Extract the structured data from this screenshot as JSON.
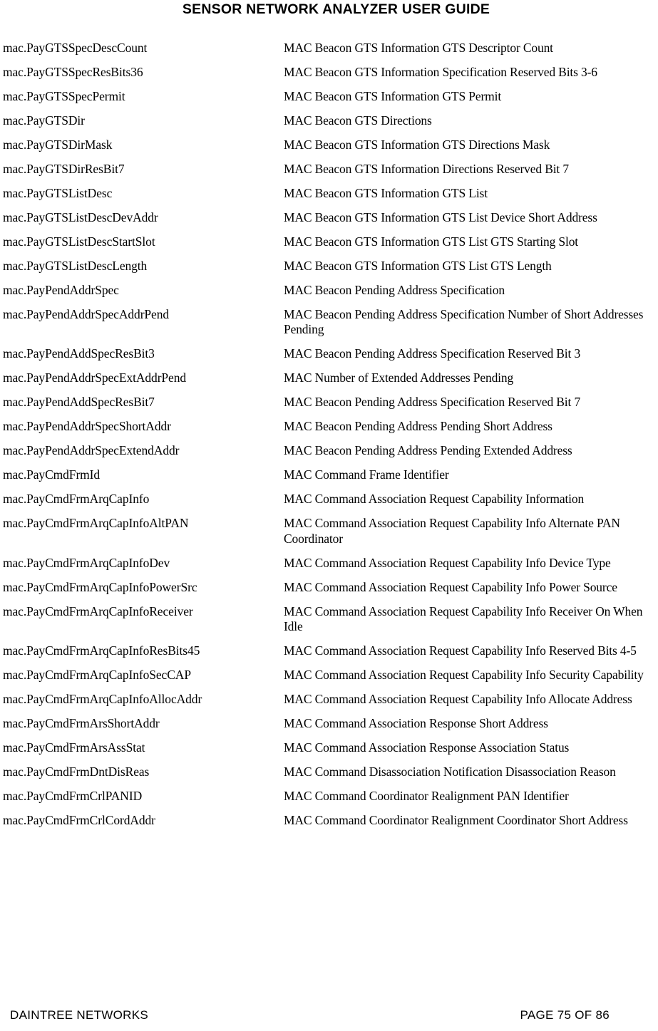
{
  "header": {
    "title": "SENSOR NETWORK ANALYZER USER GUIDE"
  },
  "footer": {
    "left": "DAINTREE NETWORKS",
    "right": "PAGE 75 OF 86"
  },
  "glossary": {
    "rows": [
      {
        "term": "mac.PayGTSSpecDescCount",
        "definition": "MAC Beacon GTS Information GTS Descriptor Count"
      },
      {
        "term": "mac.PayGTSSpecResBits36",
        "definition": "MAC Beacon GTS Information Specification Reserved Bits 3-6"
      },
      {
        "term": "mac.PayGTSSpecPermit",
        "definition": "MAC Beacon GTS Information GTS Permit"
      },
      {
        "term": "mac.PayGTSDir",
        "definition": "MAC Beacon GTS Directions"
      },
      {
        "term": "mac.PayGTSDirMask",
        "definition": "MAC Beacon GTS Information GTS Directions Mask"
      },
      {
        "term": "mac.PayGTSDirResBit7",
        "definition": "MAC Beacon GTS Information Directions Reserved Bit 7"
      },
      {
        "term": "mac.PayGTSListDesc",
        "definition": "MAC Beacon GTS Information GTS List"
      },
      {
        "term": "mac.PayGTSListDescDevAddr",
        "definition": "MAC Beacon GTS Information GTS List Device Short Address"
      },
      {
        "term": "mac.PayGTSListDescStartSlot",
        "definition": "MAC Beacon GTS Information GTS List GTS Starting Slot"
      },
      {
        "term": "mac.PayGTSListDescLength",
        "definition": "MAC Beacon GTS Information GTS List GTS Length"
      },
      {
        "term": "mac.PayPendAddrSpec",
        "definition": "MAC Beacon Pending Address Specification"
      },
      {
        "term": "mac.PayPendAddrSpecAddrPend",
        "definition": "MAC Beacon Pending Address Specification Number of Short Addresses Pending"
      },
      {
        "term": "mac.PayPendAddSpecResBit3",
        "definition": "MAC Beacon Pending Address Specification Reserved Bit 3"
      },
      {
        "term": "mac.PayPendAddrSpecExtAddrPend",
        "definition": "MAC Number of Extended Addresses Pending"
      },
      {
        "term": "mac.PayPendAddSpecResBit7",
        "definition": "MAC Beacon Pending Address Specification Reserved Bit 7"
      },
      {
        "term": "mac.PayPendAddrSpecShortAddr",
        "definition": "MAC Beacon Pending Address Pending Short Address"
      },
      {
        "term": "mac.PayPendAddrSpecExtendAddr",
        "definition": "MAC Beacon Pending Address Pending Extended Address"
      },
      {
        "term": "mac.PayCmdFrmId",
        "definition": "MAC Command Frame Identifier"
      },
      {
        "term": "mac.PayCmdFrmArqCapInfo",
        "definition": "MAC Command Association Request Capability Information"
      },
      {
        "term": "mac.PayCmdFrmArqCapInfoAltPAN",
        "definition": "MAC Command Association Request Capability Info Alternate PAN Coordinator"
      },
      {
        "term": "mac.PayCmdFrmArqCapInfoDev",
        "definition": "MAC Command Association Request Capability Info Device Type"
      },
      {
        "term": "mac.PayCmdFrmArqCapInfoPowerSrc",
        "definition": "MAC Command Association Request Capability Info Power Source"
      },
      {
        "term": "mac.PayCmdFrmArqCapInfoReceiver",
        "definition": "MAC Command Association Request Capability Info Receiver On When Idle"
      },
      {
        "term": "mac.PayCmdFrmArqCapInfoResBits45",
        "definition": "MAC Command Association Request Capability Info Reserved Bits 4-5"
      },
      {
        "term": "mac.PayCmdFrmArqCapInfoSecCAP",
        "definition": "MAC Command Association Request Capability Info Security Capability"
      },
      {
        "term": "mac.PayCmdFrmArqCapInfoAllocAddr",
        "definition": "MAC Command Association Request Capability Info Allocate Address"
      },
      {
        "term": "mac.PayCmdFrmArsShortAddr",
        "definition": "MAC Command Association Response Short Address"
      },
      {
        "term": "mac.PayCmdFrmArsAssStat",
        "definition": "MAC Command Association Response Association Status"
      },
      {
        "term": "mac.PayCmdFrmDntDisReas",
        "definition": "MAC Command Disassociation Notification Disassociation Reason"
      },
      {
        "term": "mac.PayCmdFrmCrlPANID",
        "definition": "MAC Command Coordinator Realignment PAN Identifier"
      },
      {
        "term": "mac.PayCmdFrmCrlCordAddr",
        "definition": "MAC Command Coordinator Realignment Coordinator Short Address"
      }
    ]
  }
}
